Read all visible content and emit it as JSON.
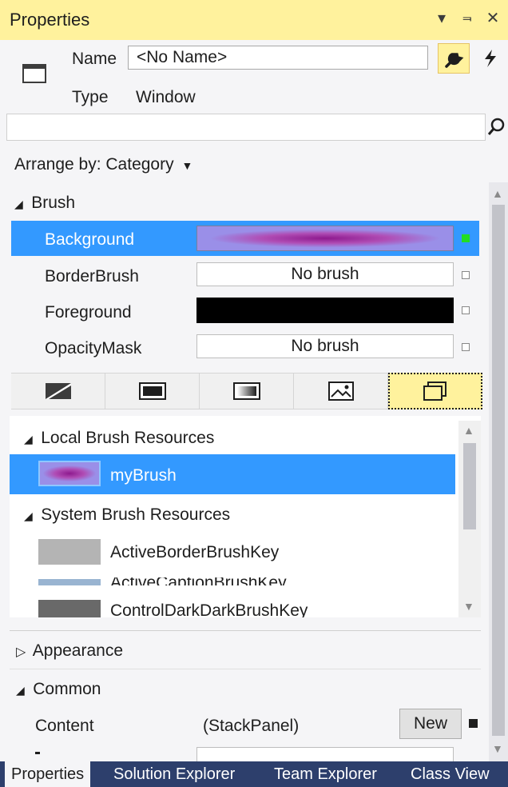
{
  "window": {
    "title": "Properties",
    "controls": [
      "▾",
      "⫬",
      "✕"
    ]
  },
  "header": {
    "name_label": "Name",
    "name_value": "<No Name>",
    "type_label": "Type",
    "type_value": "Window",
    "search_placeholder": ""
  },
  "arrange_by": "Arrange by: Category",
  "brush": {
    "category": "Brush",
    "properties": [
      {
        "name": "Background",
        "value": "",
        "selected": true
      },
      {
        "name": "BorderBrush",
        "value": "No brush",
        "selected": false
      },
      {
        "name": "Foreground",
        "value": "",
        "selected": false
      },
      {
        "name": "OpacityMask",
        "value": "No brush",
        "selected": false
      }
    ],
    "editor_tabs": [
      "null-brush",
      "solid-color-brush",
      "gradient-brush",
      "tile-brush",
      "brush-resources"
    ]
  },
  "resources": {
    "local_header": "Local Brush Resources",
    "local_items": [
      "myBrush"
    ],
    "system_header": "System Brush Resources",
    "system_items": [
      "ActiveBorderBrushKey",
      "ActiveCaptionBrushKey",
      "ControlDarkDarkBrushKey"
    ]
  },
  "categories": {
    "appearance": "Appearance",
    "common": "Common"
  },
  "common": {
    "content_label": "Content",
    "content_value": "(StackPanel)",
    "new_button": "New"
  },
  "bottom_tabs": [
    "Properties",
    "Solution Explorer",
    "Team Explorer",
    "Class View"
  ],
  "colors": {
    "title_bar": "#fff29d",
    "selection": "#3399ff",
    "tab_strip": "#2d3f6c"
  }
}
